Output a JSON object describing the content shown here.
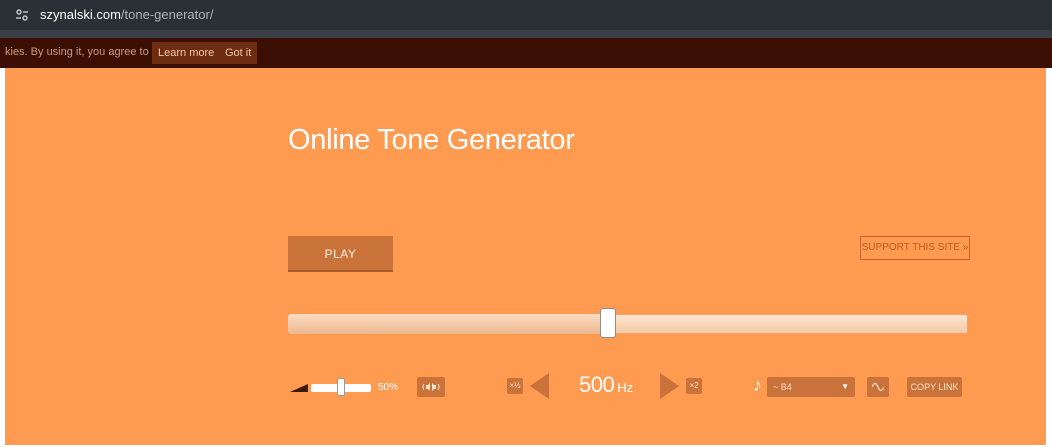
{
  "browser": {
    "url_host": "szynalski.com",
    "url_path": "/tone-generator/"
  },
  "cookie_bar": {
    "text": "kies. By using it, you agree to this.",
    "learn_more_label": "Learn more",
    "got_it_label": "Got it"
  },
  "page": {
    "title": "Online Tone Generator",
    "background_color": "#ff9b51",
    "accent_color": "#c9723a"
  },
  "controls": {
    "play_label": "PLAY",
    "support_label": "SUPPORT THIS SITE »",
    "frequency_slider_fraction": 0.47,
    "volume_text": "50%",
    "volume_fraction": 0.5,
    "half_label": "×½",
    "double_label": "×2",
    "frequency_value": "500",
    "frequency_unit": "Hz",
    "note_value": "~ B4",
    "copy_link_label": "COPY LINK"
  },
  "icons": {
    "site_info": "site-info-icon",
    "volume": "volume-icon",
    "balance": "balance-icon",
    "note": "music-note-icon",
    "dropdown": "chevron-down-icon",
    "wave": "sine-wave-icon",
    "arrow_left": "arrow-left-icon",
    "arrow_right": "arrow-right-icon"
  }
}
